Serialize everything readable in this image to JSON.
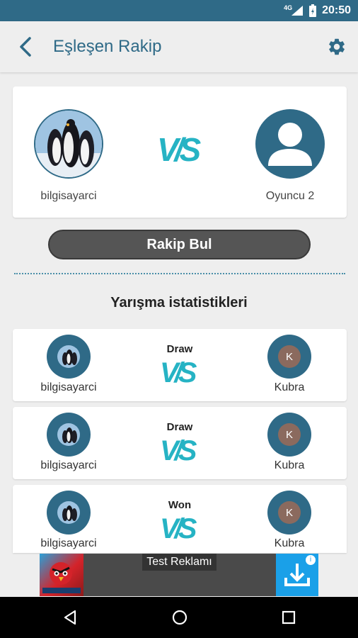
{
  "status": {
    "time": "20:50",
    "network": "4G"
  },
  "header": {
    "title": "Eşleşen Rakip"
  },
  "match": {
    "player1": {
      "name": "bilgisayarci"
    },
    "vs": "V/S",
    "player2": {
      "name": "Oyuncu 2"
    }
  },
  "find_button": "Rakip Bul",
  "stats": {
    "heading": "Yarışma istatistikleri",
    "games": [
      {
        "player": "bilgisayarci",
        "result": "Draw",
        "opponent": "Kubra",
        "opponent_initial": "K"
      },
      {
        "player": "bilgisayarci",
        "result": "Draw",
        "opponent": "Kubra",
        "opponent_initial": "K"
      },
      {
        "player": "bilgisayarci",
        "result": "Won",
        "opponent": "Kubra",
        "opponent_initial": "K"
      }
    ]
  },
  "ad": {
    "label": "Test Reklamı"
  },
  "colors": {
    "primary": "#2f6a87",
    "accent": "#26b3c4",
    "background": "#eeeeee"
  }
}
